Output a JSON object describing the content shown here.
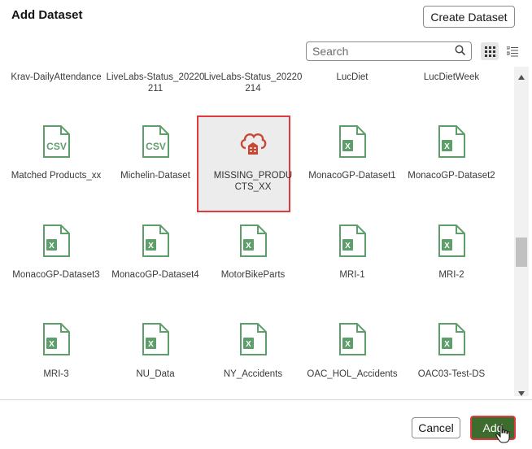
{
  "dialog": {
    "title": "Add Dataset",
    "create_label": "Create Dataset",
    "search_placeholder": "Search",
    "cancel_label": "Cancel",
    "add_label": "Add"
  },
  "datasets": [
    {
      "label": "Krav-DailyAttendance",
      "kind": "none"
    },
    {
      "label": "LiveLabs-Status_20220211",
      "kind": "none"
    },
    {
      "label": "LiveLabs-Status_20220214",
      "kind": "none"
    },
    {
      "label": "LucDiet",
      "kind": "none"
    },
    {
      "label": "LucDietWeek",
      "kind": "none"
    },
    {
      "label": "Matched Products_xx",
      "kind": "csv"
    },
    {
      "label": "Michelin-Dataset",
      "kind": "csv"
    },
    {
      "label": "MISSING_PRODUCTS_XX",
      "kind": "cloud"
    },
    {
      "label": "MonacoGP-Dataset1",
      "kind": "excel"
    },
    {
      "label": "MonacoGP-Dataset2",
      "kind": "excel"
    },
    {
      "label": "MonacoGP-Dataset3",
      "kind": "excel"
    },
    {
      "label": "MonacoGP-Dataset4",
      "kind": "excel"
    },
    {
      "label": "MotorBikeParts",
      "kind": "excel"
    },
    {
      "label": "MRI-1",
      "kind": "excel"
    },
    {
      "label": "MRI-2",
      "kind": "excel"
    },
    {
      "label": "MRI-3",
      "kind": "excel"
    },
    {
      "label": "NU_Data",
      "kind": "excel"
    },
    {
      "label": "NY_Accidents",
      "kind": "excel"
    },
    {
      "label": "OAC_HOL_Accidents",
      "kind": "excel"
    },
    {
      "label": "OAC03-Test-DS",
      "kind": "excel"
    }
  ],
  "selected_dataset": "MISSING_PRODUCTS_XX",
  "colors": {
    "file_icon_green": "#5e9e6b",
    "cloud_icon_red": "#c74634",
    "add_button": "#3e6b2e",
    "highlight_border": "#e0393e"
  },
  "icons": {
    "csv": "csv-file-icon",
    "excel": "excel-file-icon",
    "cloud": "cloud-database-icon",
    "search": "search-icon",
    "grid_view": "grid-view-icon",
    "list_view": "list-view-icon"
  }
}
